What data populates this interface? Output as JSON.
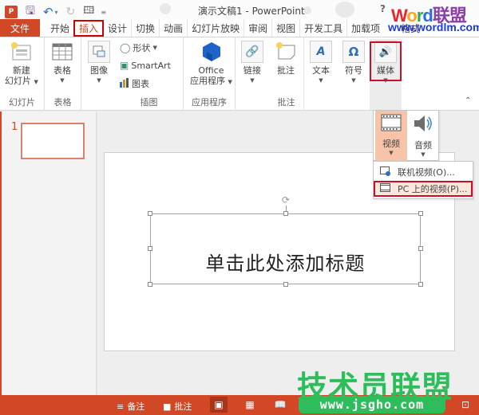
{
  "titlebar": {
    "title": "演示文稿1 - PowerPoint",
    "app_logo": "P",
    "help": "?",
    "qat": [
      "save-icon",
      "undo-icon",
      "redo-icon",
      "start-from-beginning-icon",
      "customize-qat-icon"
    ]
  },
  "tabs": [
    {
      "label": "文件"
    },
    {
      "label": "开始"
    },
    {
      "label": "插入"
    },
    {
      "label": "设计"
    },
    {
      "label": "切换"
    },
    {
      "label": "动画"
    },
    {
      "label": "幻灯片放映"
    },
    {
      "label": "审阅"
    },
    {
      "label": "视图"
    },
    {
      "label": "开发工具"
    },
    {
      "label": "加载项"
    },
    {
      "label": "格式"
    }
  ],
  "ribbon": {
    "groups": {
      "slides": {
        "label": "幻灯片",
        "new_slide_line1": "新建",
        "new_slide_line2": "幻灯片"
      },
      "tables": {
        "label": "表格",
        "table": "表格"
      },
      "images": {
        "image": "图像"
      },
      "illustrations": {
        "label": "插图",
        "shapes": "形状",
        "smartart": "SmartArt",
        "chart": "图表"
      },
      "apps": {
        "label": "应用程序",
        "office_line1": "Office",
        "office_line2": "应用程序"
      },
      "links": {
        "link": "链接"
      },
      "comments": {
        "label": "批注",
        "comment": "批注"
      },
      "text": {
        "text": "文本"
      },
      "symbols": {
        "symbol": "符号"
      },
      "media": {
        "media": "媒体"
      }
    }
  },
  "media_dropdown": {
    "video": "视频",
    "audio": "音频",
    "submenu": [
      {
        "label": "联机视频(O)..."
      },
      {
        "label": "PC 上的视频(P)..."
      }
    ]
  },
  "thumbnails": [
    {
      "number": "1"
    }
  ],
  "slide": {
    "title_placeholder": "单击此处添加标题"
  },
  "statusbar": {
    "notes": "备注",
    "comments": "批注"
  },
  "watermarks": {
    "word_w": "W",
    "word_o": "o",
    "word_r": "r",
    "word_d": "d",
    "word_cn": "联盟",
    "word_url": "www.wordlm.com",
    "jsgho": "技术员联盟",
    "jsgho_url": "www.jsgho.com"
  }
}
